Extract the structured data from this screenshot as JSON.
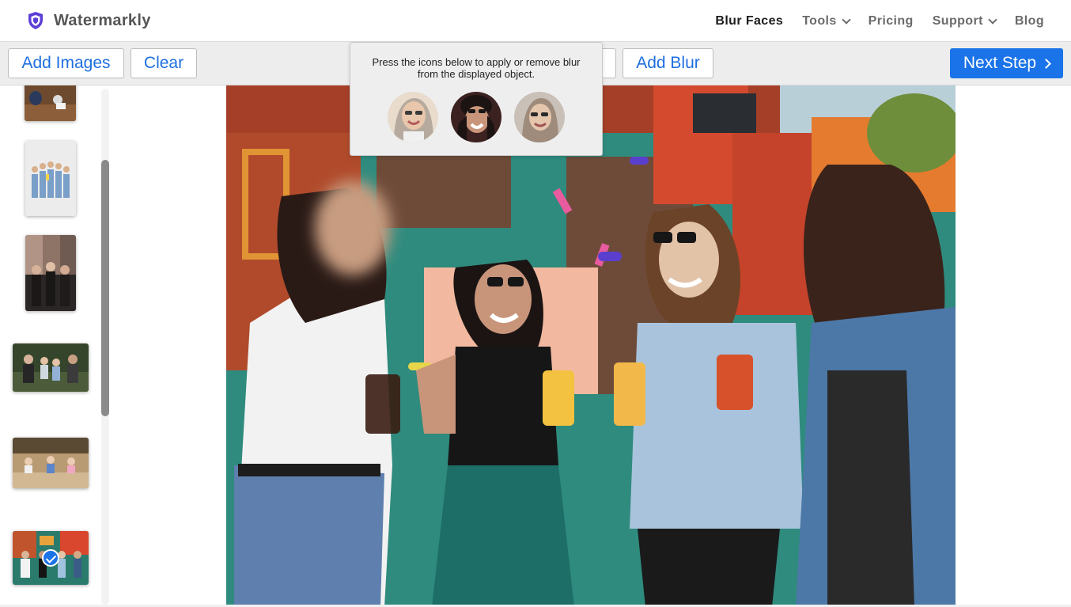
{
  "brand": {
    "name": "Watermarkly",
    "logo_icon": "shield-icon",
    "logo_color": "#5b3fd6"
  },
  "nav": {
    "items": [
      {
        "label": "Blur Faces",
        "active": true
      },
      {
        "label": "Tools",
        "dropdown": true
      },
      {
        "label": "Pricing"
      },
      {
        "label": "Support",
        "dropdown": true
      },
      {
        "label": "Blog"
      }
    ]
  },
  "toolbar": {
    "add_images_label": "Add Images",
    "clear_label": "Clear",
    "add_blur_label": "Add Blur",
    "next_step_label": "Next Step",
    "accent": "#1a73e8"
  },
  "popover": {
    "text": "Press the icons below to apply or remove blur from the displayed object.",
    "faces": [
      "face-thumbnail-1",
      "face-thumbnail-2",
      "face-thumbnail-3"
    ]
  },
  "sidebar": {
    "thumbnails": [
      "thumbnail-1",
      "thumbnail-2",
      "thumbnail-3",
      "thumbnail-4",
      "thumbnail-5",
      "thumbnail-6"
    ],
    "selected_index": 5
  },
  "main": {
    "image": "four women holding beer glasses in front of a mural"
  }
}
